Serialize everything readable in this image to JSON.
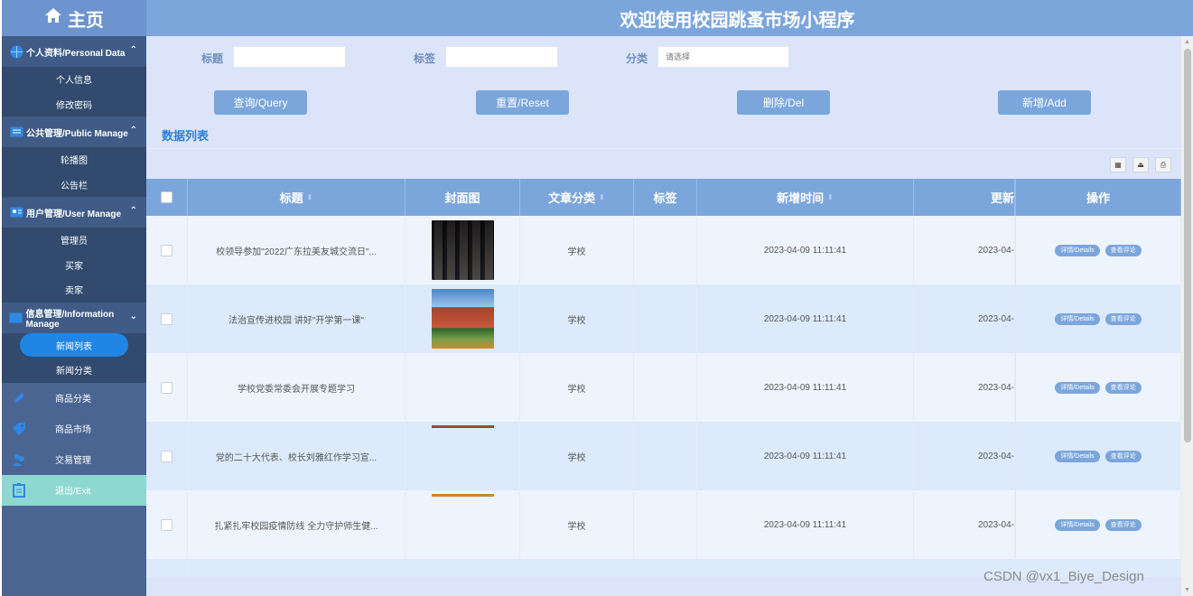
{
  "sidebar": {
    "home_label": "主页",
    "groups": [
      {
        "label": "个人资料/Personal Data",
        "items": [
          "个人信息",
          "修改密码"
        ]
      },
      {
        "label": "公共管理/Public Manage",
        "items": [
          "轮播图",
          "公告栏"
        ]
      },
      {
        "label": "用户管理/User Manage",
        "items": [
          "管理员",
          "买家",
          "卖家"
        ]
      },
      {
        "label": "信息管理/Information Manage",
        "items": [
          "新闻列表",
          "新闻分类"
        ]
      }
    ],
    "items": [
      "商品分类",
      "商品市场",
      "交易管理",
      "退出/Exit"
    ]
  },
  "header": {
    "title": "欢迎使用校园跳蚤市场小程序"
  },
  "search": {
    "title_label": "标题",
    "tag_label": "标签",
    "category_label": "分类",
    "category_placeholder": "请选择"
  },
  "buttons": {
    "query": "查询/Query",
    "reset": "重置/Reset",
    "delete": "删除/Del",
    "add": "新增/Add"
  },
  "section_title": "数据列表",
  "table": {
    "headers": {
      "title": "标题",
      "cover": "封面图",
      "category": "文章分类",
      "tag": "标签",
      "created": "新增时间",
      "updated": "更新",
      "ops": "操作"
    },
    "rows": [
      {
        "title": "校领导参加\"2022广东拉美友城交流日\"...",
        "category": "学校",
        "created": "2023-04-09 11:11:41",
        "updated": "2023-04-"
      },
      {
        "title": "法治宣传进校园 讲好\"开学第一课\"",
        "category": "学校",
        "created": "2023-04-09 11:11:41",
        "updated": "2023-04-"
      },
      {
        "title": "学校党委常委会开展专题学习",
        "category": "学校",
        "created": "2023-04-09 11:11:41",
        "updated": "2023-04-"
      },
      {
        "title": "党的二十大代表、校长刘雅红作学习宣...",
        "category": "学校",
        "created": "2023-04-09 11:11:41",
        "updated": "2023-04-"
      },
      {
        "title": "扎紧扎牢校园疫情防线 全力守护师生健...",
        "category": "学校",
        "created": "2023-04-09 11:11:41",
        "updated": "2023-04-"
      }
    ],
    "details_label": "详情/Details",
    "comments_label": "查看评论"
  },
  "watermark": "CSDN @vx1_Biye_Design"
}
